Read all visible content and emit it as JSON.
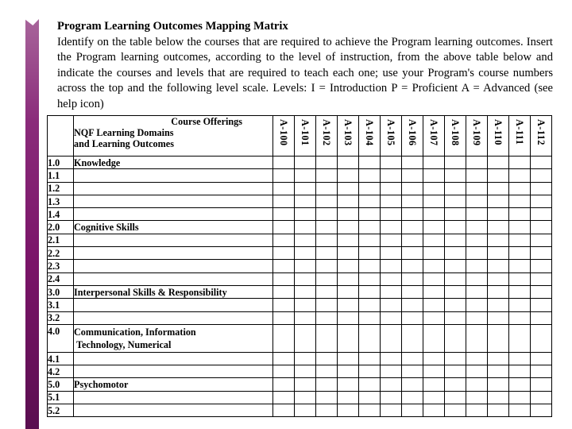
{
  "slide": {
    "title": "Program Learning Outcomes Mapping Matrix",
    "instructions": "Identify on the table below the courses that are required to achieve the Program learning outcomes. Insert the Program learning outcomes, according to the level of instruction, from the above table below and indicate the courses and levels that are required to teach each one; use your Program's course numbers across the top and the following level scale.  Levels:  I = Introduction   P = Proficient   A = Advanced (see help icon)",
    "accent_color": "#7a1468"
  },
  "matrix": {
    "header": {
      "course_offerings_label": "Course Offerings",
      "domains_label_line1": "NQF Learning Domains",
      "domains_label_line2": "and Learning Outcomes"
    },
    "courses": [
      "A-100",
      "A-101",
      "A-102",
      "A-103",
      "A-104",
      "A-105",
      "A-106",
      "A-107",
      "A-108",
      "A-109",
      "A-110",
      "A-111",
      "A-112"
    ],
    "rows": [
      {
        "num": "1.0",
        "label": "Knowledge"
      },
      {
        "num": "1.1",
        "label": ""
      },
      {
        "num": "1.2",
        "label": ""
      },
      {
        "num": "1.3",
        "label": ""
      },
      {
        "num": "1.4",
        "label": ""
      },
      {
        "num": "2.0",
        "label": "Cognitive Skills"
      },
      {
        "num": "2.1",
        "label": ""
      },
      {
        "num": "2.2",
        "label": ""
      },
      {
        "num": "2.3",
        "label": ""
      },
      {
        "num": "2.4",
        "label": ""
      },
      {
        "num": "3.0",
        "label": "Interpersonal Skills & Responsibility"
      },
      {
        "num": "3.1",
        "label": ""
      },
      {
        "num": "3.2",
        "label": ""
      },
      {
        "num": "4.0",
        "label": "Communication, Information",
        "label2": "Technology, Numerical"
      },
      {
        "num": "4.1",
        "label": ""
      },
      {
        "num": "4.2",
        "label": ""
      },
      {
        "num": "5.0",
        "label": "Psychomotor"
      },
      {
        "num": "5.1",
        "label": ""
      },
      {
        "num": "5.2",
        "label": ""
      }
    ]
  }
}
